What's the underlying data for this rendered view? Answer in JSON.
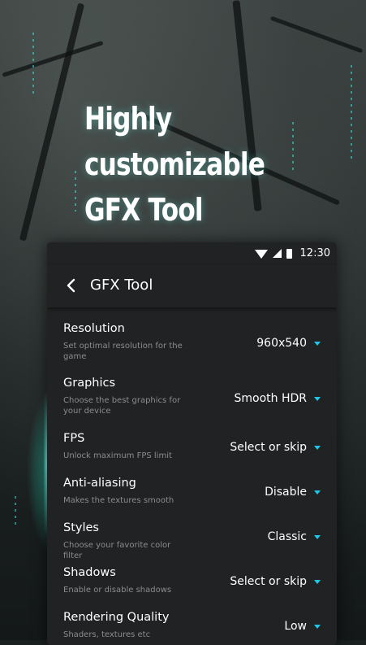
{
  "headline": {
    "line1": "Highly customizable",
    "line2": "GFX Tool"
  },
  "status_bar": {
    "time": "12:30"
  },
  "toolbar": {
    "title": "GFX Tool"
  },
  "settings": [
    {
      "label": "Resolution",
      "description": "Set optimal resolution for the game",
      "value": "960x540"
    },
    {
      "label": "Graphics",
      "description": "Choose the best graphics for your device",
      "value": "Smooth HDR"
    },
    {
      "label": "FPS",
      "description": "Unlock maximum FPS limit",
      "value": "Select or skip"
    },
    {
      "label": "Anti-aliasing",
      "description": "Makes the textures smooth",
      "value": "Disable"
    },
    {
      "label": "Styles",
      "description": "Choose your favorite color filter",
      "value": "Classic"
    },
    {
      "label": "Shadows",
      "description": "Enable or disable shadows",
      "value": "Select or skip"
    },
    {
      "label": "Rendering Quality",
      "description": "Shaders, textures etc",
      "value": "Low"
    }
  ],
  "colors": {
    "accent": "#1ec6e8",
    "panel": "#202223",
    "glow": "#3fe2d0"
  },
  "icons": {
    "back": "back-arrow-icon",
    "dropdown": "dropdown-caret-icon",
    "wifi": "wifi-icon",
    "signal": "signal-icon",
    "battery": "battery-icon"
  }
}
